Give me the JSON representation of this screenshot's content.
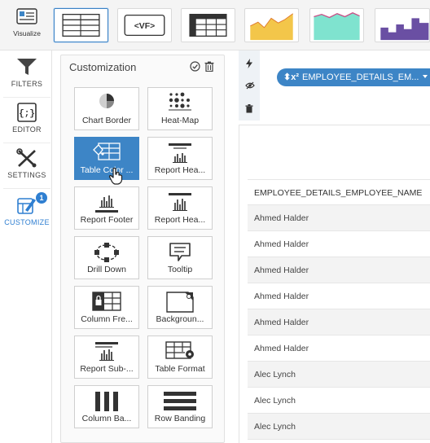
{
  "topbar": {
    "visualize_label": "Visualize",
    "thumbs": [
      {
        "name": "table-chart-thumb",
        "icon": "table-grid"
      },
      {
        "name": "vf-chart-thumb",
        "icon": "vf-code",
        "text": "<VF>"
      },
      {
        "name": "pivot-table-thumb",
        "icon": "pivot-grid"
      },
      {
        "name": "area-chart-thumb",
        "icon": "yellow-area"
      },
      {
        "name": "stacked-area-chart-thumb",
        "icon": "teal-area"
      },
      {
        "name": "step-chart-thumb",
        "icon": "purple-step"
      }
    ]
  },
  "leftnav": {
    "items": [
      {
        "label": "FILTERS",
        "icon": "funnel-icon"
      },
      {
        "label": "EDITOR",
        "icon": "code-braces-icon"
      },
      {
        "label": "SETTINGS",
        "icon": "tools-icon"
      },
      {
        "label": "CUSTOMIZE",
        "icon": "customize-icon",
        "badge": "1"
      }
    ]
  },
  "panel": {
    "title": "Customization",
    "options": [
      {
        "label": "Chart Border",
        "icon": "chart-border-icon"
      },
      {
        "label": "Heat-Map",
        "icon": "heat-map-icon"
      },
      {
        "label": "Table Color ...",
        "icon": "table-color-icon",
        "active": true
      },
      {
        "label": "Report Hea...",
        "icon": "report-header-icon"
      },
      {
        "label": "Report Footer",
        "icon": "report-footer-icon"
      },
      {
        "label": "Report Hea...",
        "icon": "report-header-2-icon"
      },
      {
        "label": "Drill Down",
        "icon": "drill-down-icon"
      },
      {
        "label": "Tooltip",
        "icon": "tooltip-icon"
      },
      {
        "label": "Column Fre...",
        "icon": "column-freeze-icon"
      },
      {
        "label": "Backgroun...",
        "icon": "background-icon"
      },
      {
        "label": "Report Sub-...",
        "icon": "report-subheader-icon"
      },
      {
        "label": "Table Format",
        "icon": "table-format-icon"
      },
      {
        "label": "Column Ba...",
        "icon": "column-banding-icon"
      },
      {
        "label": "Row Banding",
        "icon": "row-banding-icon"
      }
    ]
  },
  "field_pill": {
    "prefix": "⬍x²",
    "label": "EMPLOYEE_DETAILS_EM..."
  },
  "table": {
    "header": "EMPLOYEE_DETAILS_EMPLOYEE_NAME",
    "rows": [
      "Ahmed Halder",
      "Ahmed Halder",
      "Ahmed Halder",
      "Ahmed Halder",
      "Ahmed Halder",
      "Ahmed Halder",
      "Alec Lynch",
      "Alec Lynch",
      "Alec Lynch"
    ]
  },
  "colors": {
    "accent": "#3d85c6",
    "area_yellow": "#f3c64a",
    "area_teal": "#7fe3cf",
    "step_purple": "#6a4fa3"
  }
}
